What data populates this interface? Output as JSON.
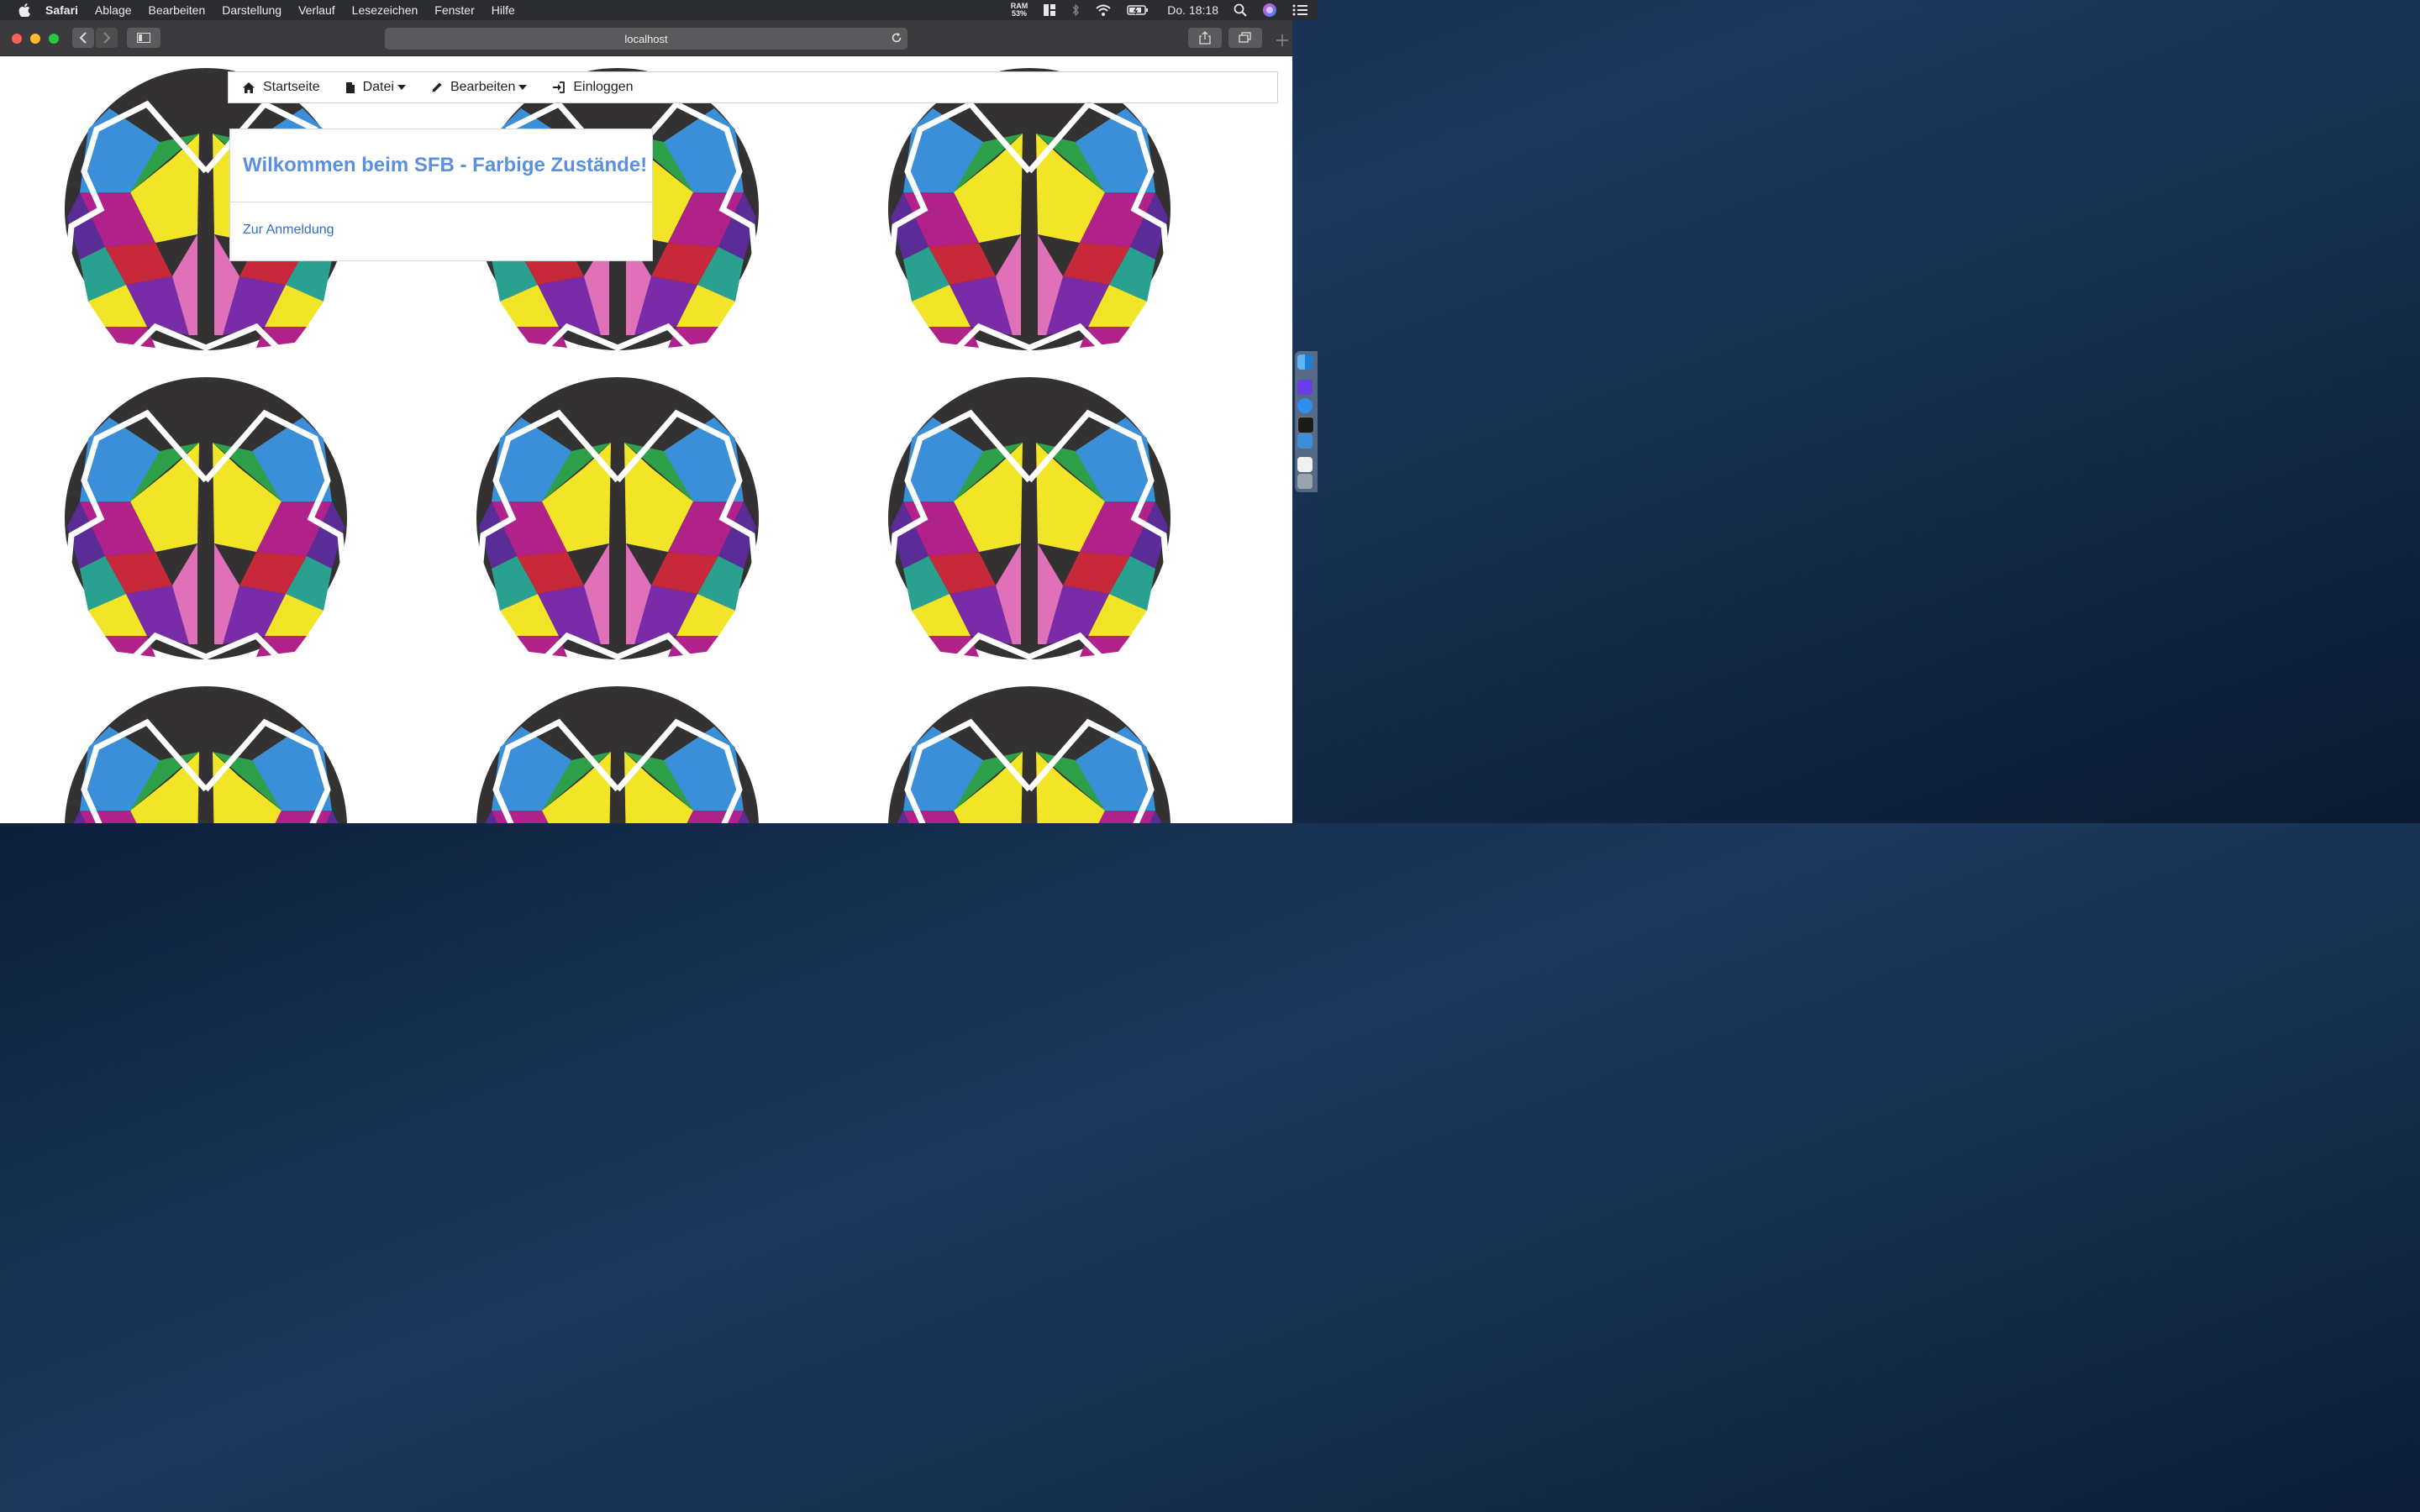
{
  "menubar": {
    "app_name": "Safari",
    "items": [
      "Ablage",
      "Bearbeiten",
      "Darstellung",
      "Verlauf",
      "Lesezeichen",
      "Fenster",
      "Hilfe"
    ],
    "ram_label": "RAM",
    "ram_value": "53%",
    "clock": "Do. 18:18"
  },
  "browser": {
    "url": "localhost"
  },
  "page": {
    "nav": {
      "home": "Startseite",
      "file": "Datei",
      "edit": "Bearbeiten",
      "login": "Einloggen"
    },
    "welcome": {
      "title": "Wilkommen beim SFB - Farbige Zustände!",
      "link": "Zur Anmeldung"
    }
  },
  "colors": {
    "title": "#5b8fe0",
    "link": "#2f6fc9",
    "logo_background": "#333132"
  }
}
